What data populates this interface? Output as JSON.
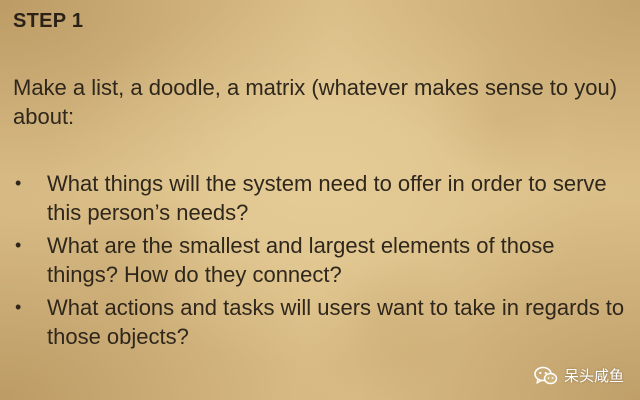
{
  "heading": "STEP 1",
  "intro": "Make a list, a doodle, a matrix (whatever makes sense to you) about:",
  "bullets": [
    {
      "marker": "•",
      "text": "What things will the system need to offer in order to serve this person’s needs?"
    },
    {
      "marker": "•",
      "text": "What are the smallest and largest elements of those things? How do they connect?"
    },
    {
      "marker": "•",
      "text": "What actions and tasks will users want to take in regards to those objects?"
    }
  ],
  "watermark": {
    "icon": "wechat-icon",
    "text": "呆头咸鱼"
  },
  "colors": {
    "paper": "#dcc08a",
    "text": "#2f271c",
    "watermark": "#ffffff"
  }
}
